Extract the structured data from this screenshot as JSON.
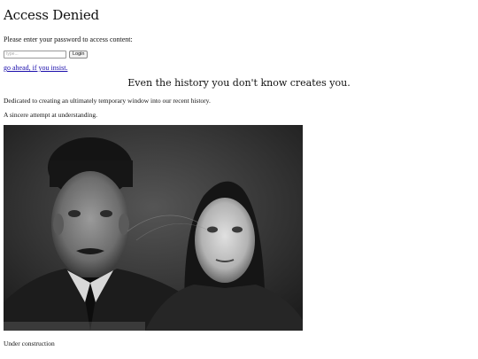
{
  "header": {
    "title": "Access Denied",
    "prompt": "Please enter your password to access content:"
  },
  "login": {
    "password_placeholder": "type...",
    "button_label": "Login",
    "bypass_link": "go ahead, if you insist."
  },
  "main": {
    "heading": "Even the history you don't know creates you.",
    "dedication": "Dedicated to creating an ultimately temporary window into our recent history.",
    "attempt": "A sincere attempt at understanding.",
    "photo_icon": "vintage-portrait-photo",
    "footer": "Under construction"
  }
}
